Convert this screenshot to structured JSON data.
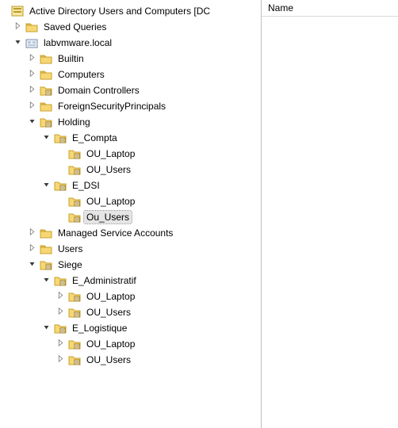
{
  "right_pane": {
    "column_header": "Name"
  },
  "tree": [
    {
      "label": "Active Directory Users and Computers [DC",
      "icon": "ad-root-icon",
      "expander": "none",
      "children": [
        {
          "label": "Saved Queries",
          "icon": "folder-icon",
          "expander": "collapsed"
        },
        {
          "label": "labvmware.local",
          "icon": "domain-icon",
          "expander": "expanded",
          "children": [
            {
              "label": "Builtin",
              "icon": "folder-icon",
              "expander": "collapsed"
            },
            {
              "label": "Computers",
              "icon": "folder-icon",
              "expander": "collapsed"
            },
            {
              "label": "Domain Controllers",
              "icon": "ou-icon",
              "expander": "collapsed"
            },
            {
              "label": "ForeignSecurityPrincipals",
              "icon": "folder-icon",
              "expander": "collapsed"
            },
            {
              "label": "Holding",
              "icon": "ou-icon",
              "expander": "expanded",
              "children": [
                {
                  "label": "E_Compta",
                  "icon": "ou-icon",
                  "expander": "expanded",
                  "children": [
                    {
                      "label": "OU_Laptop",
                      "icon": "ou-icon",
                      "expander": "none"
                    },
                    {
                      "label": "OU_Users",
                      "icon": "ou-icon",
                      "expander": "none"
                    }
                  ]
                },
                {
                  "label": "E_DSI",
                  "icon": "ou-icon",
                  "expander": "expanded",
                  "children": [
                    {
                      "label": "OU_Laptop",
                      "icon": "ou-icon",
                      "expander": "none"
                    },
                    {
                      "label": "Ou_Users",
                      "icon": "ou-icon",
                      "expander": "none",
                      "selected": true
                    }
                  ]
                }
              ]
            },
            {
              "label": "Managed Service Accounts",
              "icon": "folder-icon",
              "expander": "collapsed"
            },
            {
              "label": "Users",
              "icon": "folder-icon",
              "expander": "collapsed"
            },
            {
              "label": "Siege",
              "icon": "ou-icon",
              "expander": "expanded",
              "children": [
                {
                  "label": "E_Administratif",
                  "icon": "ou-icon",
                  "expander": "expanded",
                  "children": [
                    {
                      "label": "OU_Laptop",
                      "icon": "ou-icon",
                      "expander": "collapsed"
                    },
                    {
                      "label": "OU_Users",
                      "icon": "ou-icon",
                      "expander": "collapsed"
                    }
                  ]
                },
                {
                  "label": "E_Logistique",
                  "icon": "ou-icon",
                  "expander": "expanded",
                  "children": [
                    {
                      "label": "OU_Laptop",
                      "icon": "ou-icon",
                      "expander": "collapsed"
                    },
                    {
                      "label": "OU_Users",
                      "icon": "ou-icon",
                      "expander": "collapsed"
                    }
                  ]
                }
              ]
            }
          ]
        }
      ]
    }
  ]
}
